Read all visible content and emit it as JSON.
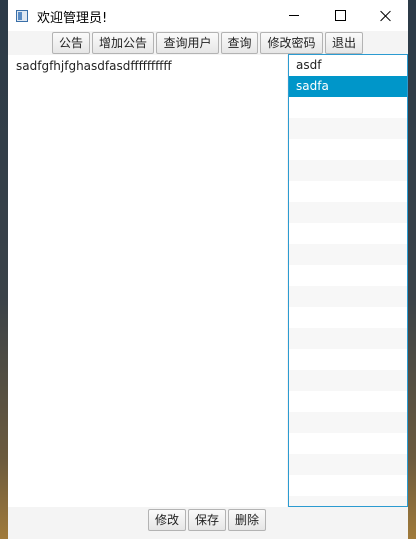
{
  "window": {
    "title": "欢迎管理员!"
  },
  "toolbar": {
    "buttons": [
      {
        "label": "公告"
      },
      {
        "label": "增加公告"
      },
      {
        "label": "查询用户"
      },
      {
        "label": "查询"
      },
      {
        "label": "修改密码"
      },
      {
        "label": "退出"
      }
    ]
  },
  "content": {
    "text": "sadfgfhjfghasdfasdffffffffff"
  },
  "list": {
    "items": [
      {
        "label": "asdf",
        "selected": false
      },
      {
        "label": "sadfa",
        "selected": true
      }
    ],
    "selection_color": "#0096c9"
  },
  "bottombar": {
    "buttons": [
      {
        "label": "修改"
      },
      {
        "label": "保存"
      },
      {
        "label": "删除"
      }
    ]
  }
}
